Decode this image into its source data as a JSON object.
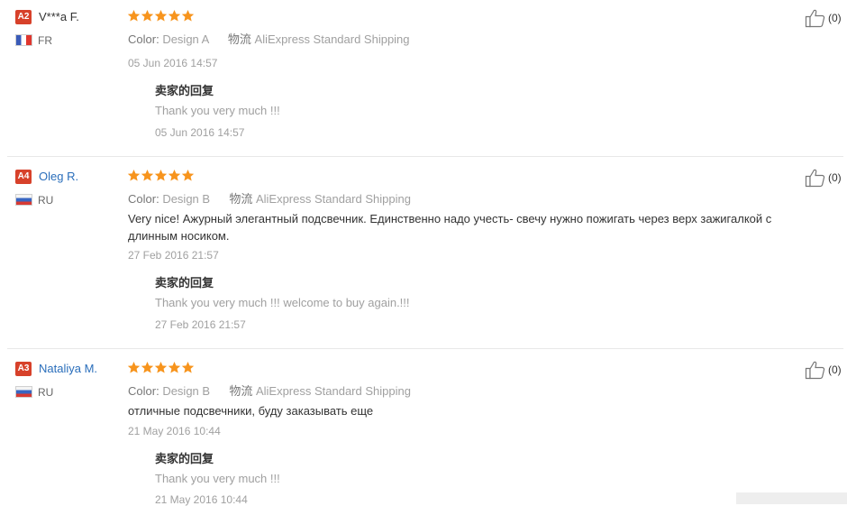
{
  "colors": {
    "star": "#f7941d",
    "level_badge": "#d7412a",
    "link": "#2a6ebb",
    "muted": "#a0a0a0"
  },
  "icons": {
    "star": "star-icon",
    "like": "thumbs-up-icon"
  },
  "reviews": [
    {
      "level": "A2",
      "name": "V***a F.",
      "country": "FR",
      "rating": 5,
      "color_key": "Color:",
      "color_value": "Design A",
      "shipping_key": "物流",
      "shipping_value": "AliExpress Standard Shipping",
      "text": "",
      "date": "05 Jun 2016 14:57",
      "reply_title": "卖家的回复",
      "reply_text": "Thank you very much !!!",
      "reply_date": "05 Jun 2016 14:57",
      "likes": "(0)"
    },
    {
      "level": "A4",
      "name": "Oleg R.",
      "country": "RU",
      "rating": 5,
      "color_key": "Color:",
      "color_value": "Design B",
      "shipping_key": "物流",
      "shipping_value": "AliExpress Standard Shipping",
      "text": "Very nice! Ажурный элегантный подсвечник. Единственно надо учесть- свечу нужно пожигать через верх зажигалкой с длинным носиком.",
      "date": "27 Feb 2016 21:57",
      "reply_title": "卖家的回复",
      "reply_text": "Thank you very much !!! welcome to buy again.!!!",
      "reply_date": "27 Feb 2016 21:57",
      "likes": "(0)"
    },
    {
      "level": "A3",
      "name": "Nataliya M.",
      "country": "RU",
      "rating": 5,
      "color_key": "Color:",
      "color_value": "Design B",
      "shipping_key": "物流",
      "shipping_value": "AliExpress Standard Shipping",
      "text": "отличные подсвечники, буду заказывать еще",
      "date": "21 May 2016 10:44",
      "reply_title": "卖家的回复",
      "reply_text": "Thank you very much !!!",
      "reply_date": "21 May 2016 10:44",
      "likes": "(0)"
    }
  ]
}
